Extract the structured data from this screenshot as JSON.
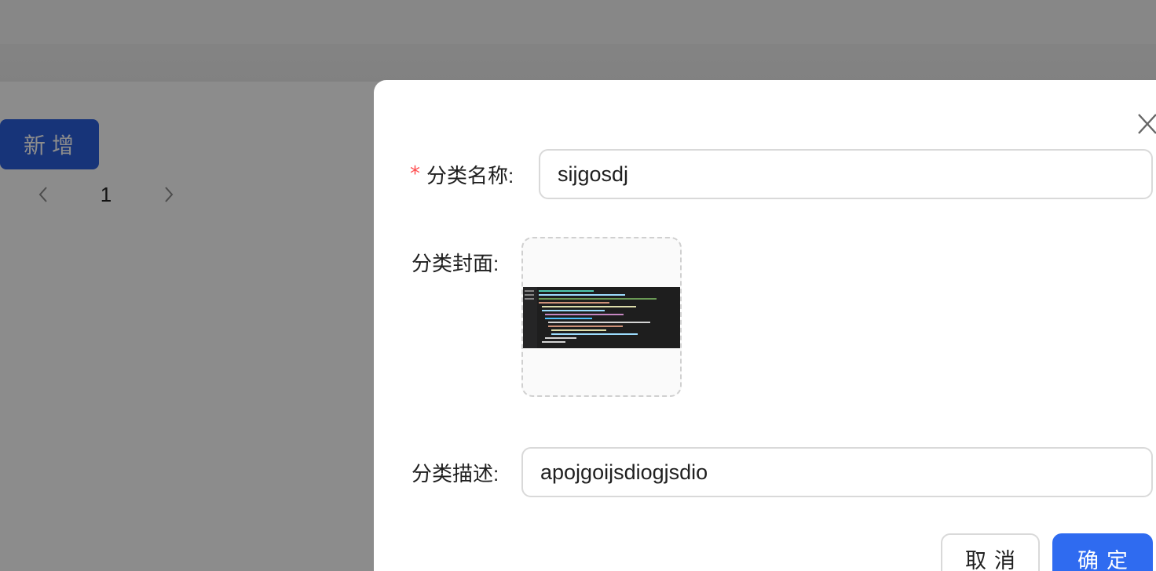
{
  "page": {
    "add_button_label": "新增",
    "pagination": {
      "current_page": "1"
    }
  },
  "modal": {
    "fields": {
      "name": {
        "label": "分类名称:",
        "required": true,
        "value": "sijgosdj"
      },
      "cover": {
        "label": "分类封面:"
      },
      "description": {
        "label": "分类描述:",
        "value": "apojgoijsdiogjsdio"
      }
    },
    "buttons": {
      "cancel_label": "取消",
      "ok_label": "确定"
    },
    "icons": {
      "close": "close-icon"
    }
  },
  "colors": {
    "primary": "#2f6bf0",
    "required_star": "#ff4d4f",
    "mask": "rgba(0,0,0,0.45)"
  }
}
